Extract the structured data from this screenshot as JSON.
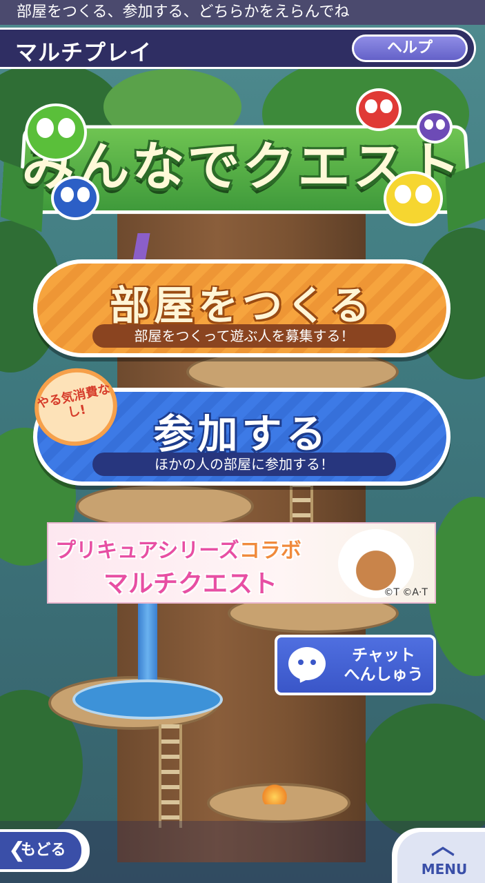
{
  "hint_text": "部屋をつくる、参加する、どちらかをえらんでね",
  "header": {
    "title": "マルチプレイ",
    "help_label": "ヘルプ"
  },
  "logo": {
    "text": "みんなでクエスト"
  },
  "create_room": {
    "label": "部屋をつくる",
    "description": "部屋をつくって遊ぶ人を募集する！"
  },
  "join_room": {
    "label": "参加する",
    "description": "ほかの人の部屋に参加する！",
    "badge_text": "やる気消費なし!"
  },
  "banner": {
    "line1": "プリキュアシリーズ",
    "line1_suffix": "コラボ",
    "line2": "マルチクエスト",
    "copyright": "©T  ©A·T"
  },
  "chat_edit": {
    "label_line1": "チャット",
    "label_line2": "へんしゅう",
    "icon": "chat-bubble-icon"
  },
  "footer": {
    "back_label": "もどる",
    "menu_label": "MENU"
  },
  "colors": {
    "header_bg": "#2f2e63",
    "create_button": "#f6a43e",
    "join_button": "#3d7ae6",
    "chat_button": "#4f6fe0"
  }
}
